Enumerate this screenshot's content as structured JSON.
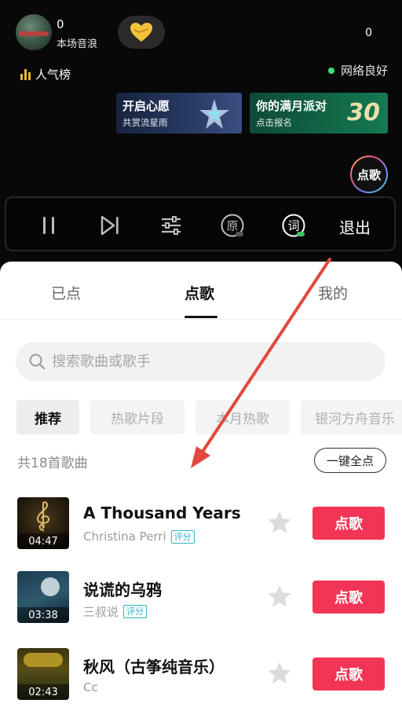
{
  "header": {
    "wave_count": "0",
    "wave_label": "本场音浪",
    "right_count": "0",
    "rank_label": "人气榜",
    "network_status": "网络良好",
    "request_song_fab": "点歌"
  },
  "banners": [
    {
      "title": "开启心愿",
      "subtitle": "共赏流星雨"
    },
    {
      "title": "你的满月派对",
      "subtitle": "点击报名",
      "badge": "30"
    }
  ],
  "controls": {
    "original_label": "原",
    "lyrics_label": "词",
    "exit_label": "退出"
  },
  "tabs": [
    {
      "label": "已点",
      "active": false
    },
    {
      "label": "点歌",
      "active": true
    },
    {
      "label": "我的",
      "active": false
    }
  ],
  "search": {
    "placeholder": "搜索歌曲或歌手"
  },
  "chips": [
    {
      "label": "推荐",
      "active": true
    },
    {
      "label": "热歌片段",
      "active": false
    },
    {
      "label": "本月热歌",
      "active": false
    },
    {
      "label": "银河方舟音乐",
      "active": false
    }
  ],
  "song_count": "共18首歌曲",
  "order_all_label": "一键全点",
  "songs": [
    {
      "title": "A Thousand Years",
      "artist": "Christina Perri",
      "tag": "评分",
      "duration": "04:47",
      "button": "点歌"
    },
    {
      "title": "说谎的乌鸦",
      "artist": "三叔说",
      "tag": "评分",
      "duration": "03:38",
      "button": "点歌"
    },
    {
      "title": "秋风（古筝纯音乐）",
      "artist": "Cc",
      "tag": "",
      "duration": "02:43",
      "button": "点歌"
    }
  ],
  "colors": {
    "accent_red": "#f23556",
    "score_tag": "#2cb7c9",
    "network_dot": "#3ee07a",
    "annotation_arrow": "#e2483d"
  }
}
